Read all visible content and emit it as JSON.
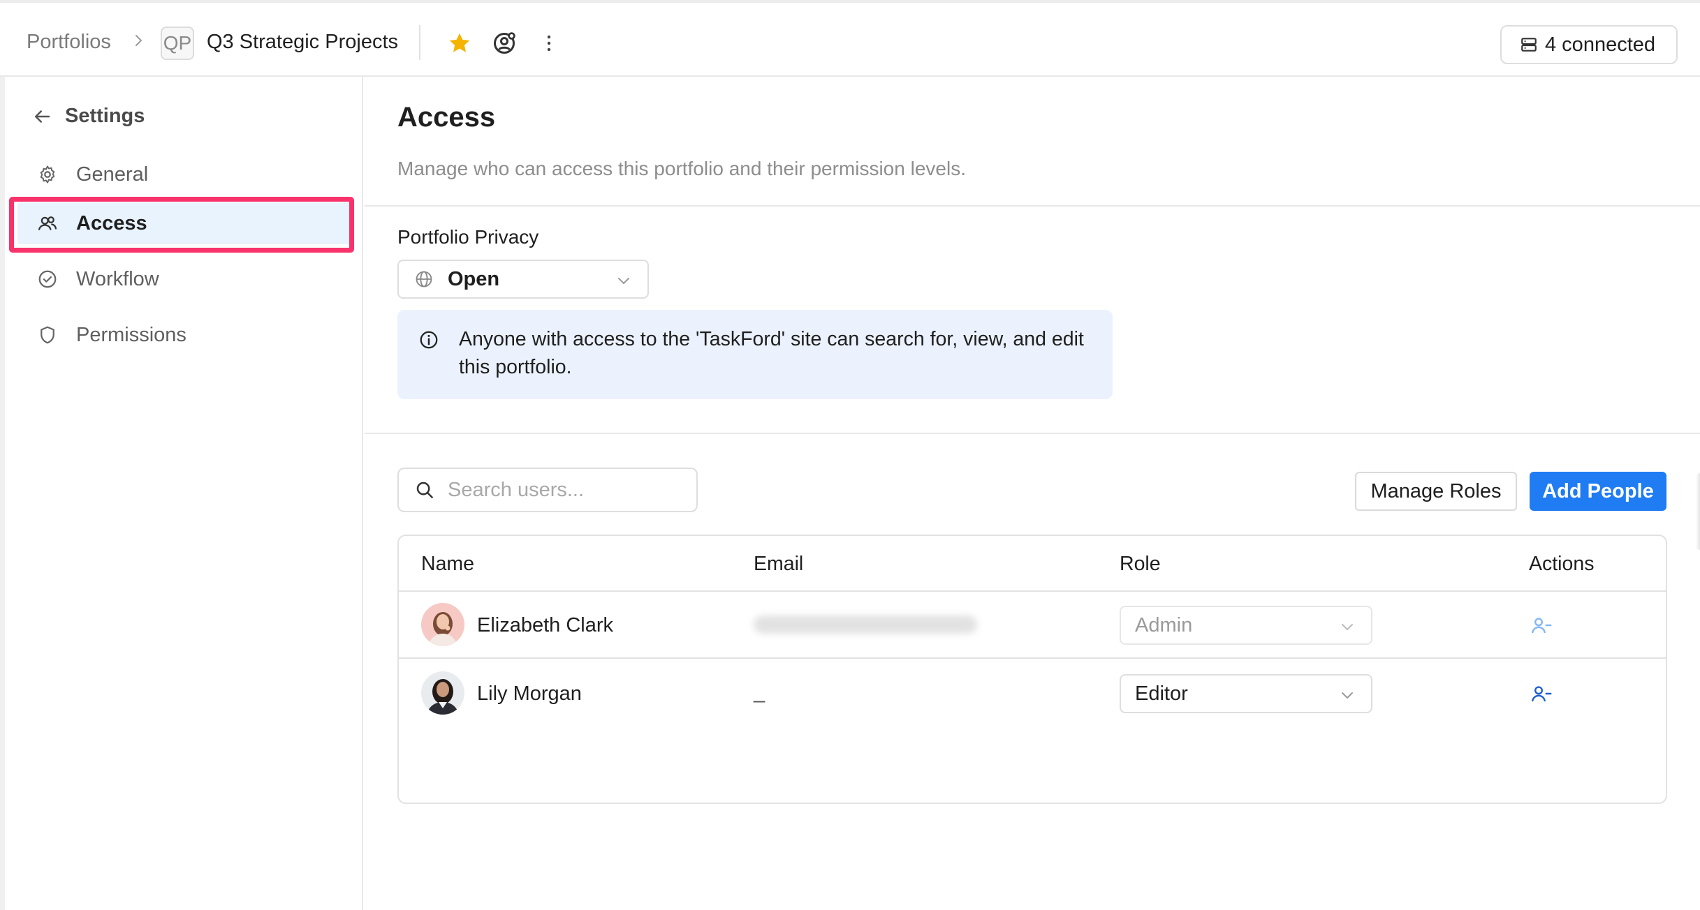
{
  "header": {
    "breadcrumb_root": "Portfolios",
    "project_badge": "QP",
    "project_title": "Q3 Strategic Projects",
    "connected_label": "4 connected",
    "icons": {
      "separator": "chevron-right-icon",
      "favorite": "star-icon",
      "target": "target-user-icon",
      "more": "more-vertical-icon",
      "connected": "server-icon"
    },
    "star_color": "#f5b400"
  },
  "sidebar": {
    "back_label": "Settings",
    "items": [
      {
        "label": "General",
        "icon": "gear-icon",
        "active": false
      },
      {
        "label": "Access",
        "icon": "users-icon",
        "active": true
      },
      {
        "label": "Workflow",
        "icon": "check-circle-icon",
        "active": false
      },
      {
        "label": "Permissions",
        "icon": "shield-icon",
        "active": false
      }
    ]
  },
  "main": {
    "title": "Access",
    "subtitle": "Manage who can access this portfolio and their permission levels.",
    "privacy": {
      "label": "Portfolio Privacy",
      "selected": "Open",
      "info_text": "Anyone with access to the 'TaskFord' site can search for, view, and edit this portfolio."
    },
    "search": {
      "placeholder": "Search users..."
    },
    "buttons": {
      "manage_roles": "Manage Roles",
      "add_people": "Add People"
    },
    "table": {
      "columns": [
        "Name",
        "Email",
        "Role",
        "Actions"
      ],
      "rows": [
        {
          "name": "Elizabeth Clark",
          "email": "",
          "role": "Admin",
          "role_disabled": true,
          "action_icon": "remove-user-icon"
        },
        {
          "name": "Lily Morgan",
          "email": "_",
          "role": "Editor",
          "role_disabled": false,
          "action_icon": "remove-user-icon"
        }
      ]
    }
  },
  "colors": {
    "accent": "#1f7cf3",
    "highlight": "#f8336b",
    "active_bg": "#e9f3fd",
    "info_bg": "#ebf2fd"
  }
}
